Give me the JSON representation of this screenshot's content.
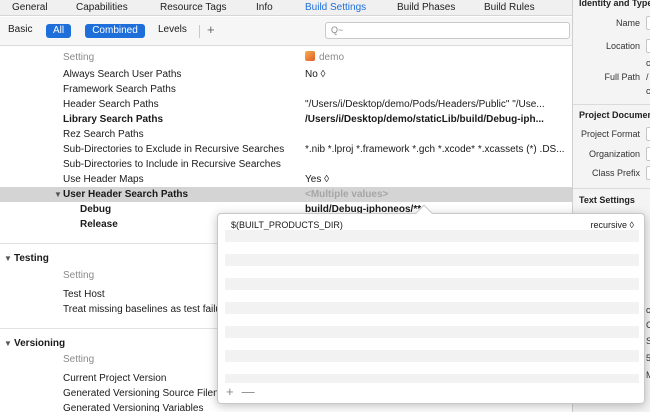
{
  "tabs": [
    "General",
    "Capabilities",
    "Resource Tags",
    "Info",
    "Build Settings",
    "Build Phases",
    "Build Rules"
  ],
  "filter": {
    "basic": "Basic",
    "all": "All",
    "combined": "Combined",
    "levels": "Levels",
    "add": "+",
    "search_icon": "Q~"
  },
  "table": {
    "header": {
      "setting": "Setting",
      "target": "demo"
    },
    "search_paths": [
      {
        "name": "Always Search User Paths",
        "value": "No ◊"
      },
      {
        "name": "Framework Search Paths",
        "value": ""
      },
      {
        "name": "Header Search Paths",
        "value": "\"/Users/i/Desktop/demo/Pods/Headers/Public\" \"/Use..."
      },
      {
        "name": "Library Search Paths",
        "value": "/Users/i/Desktop/demo/staticLib/build/Debug-iph..."
      },
      {
        "name": "Rez Search Paths",
        "value": ""
      },
      {
        "name": "Sub-Directories to Exclude in Recursive Searches",
        "value": "*.nib *.lproj *.framework *.gch *.xcode* *.xcassets (*) .DS..."
      },
      {
        "name": "Sub-Directories to Include in Recursive Searches",
        "value": ""
      },
      {
        "name": "Use Header Maps",
        "value": "Yes ◊"
      }
    ],
    "selected": {
      "name": "User Header Search Paths",
      "value": "<Multiple values>"
    },
    "children": [
      {
        "name": "Debug",
        "value": "build/Debug-iphoneos/**"
      },
      {
        "name": "Release",
        "value": ""
      }
    ],
    "testing": {
      "title": "Testing",
      "header": "Setting",
      "rows": [
        "Test Host",
        "Treat missing baselines as test failu"
      ]
    },
    "versioning": {
      "title": "Versioning",
      "header": "Setting",
      "rows": [
        "Current Project Version",
        "Generated Versioning Source Filena",
        "Generated Versioning Variables"
      ]
    }
  },
  "popover": {
    "entry": "$(BUILT_PRODUCTS_DIR)",
    "mode": "recursive",
    "footer": {
      "add": "+",
      "remove": "—"
    }
  },
  "inspector": {
    "identity_title": "Identity and Type",
    "name_label": "Name",
    "location_label": "Location",
    "fullpath_label": "Full Path",
    "fullpath_values": [
      "c",
      "/",
      "c"
    ],
    "project_doc_title": "Project Document",
    "format_label": "Project Format",
    "org_label": "Organization",
    "prefix_label": "Class Prefix",
    "text_title": "Text Settings",
    "lower_values": [
      "c",
      "C",
      "S",
      "5",
      "M"
    ]
  }
}
